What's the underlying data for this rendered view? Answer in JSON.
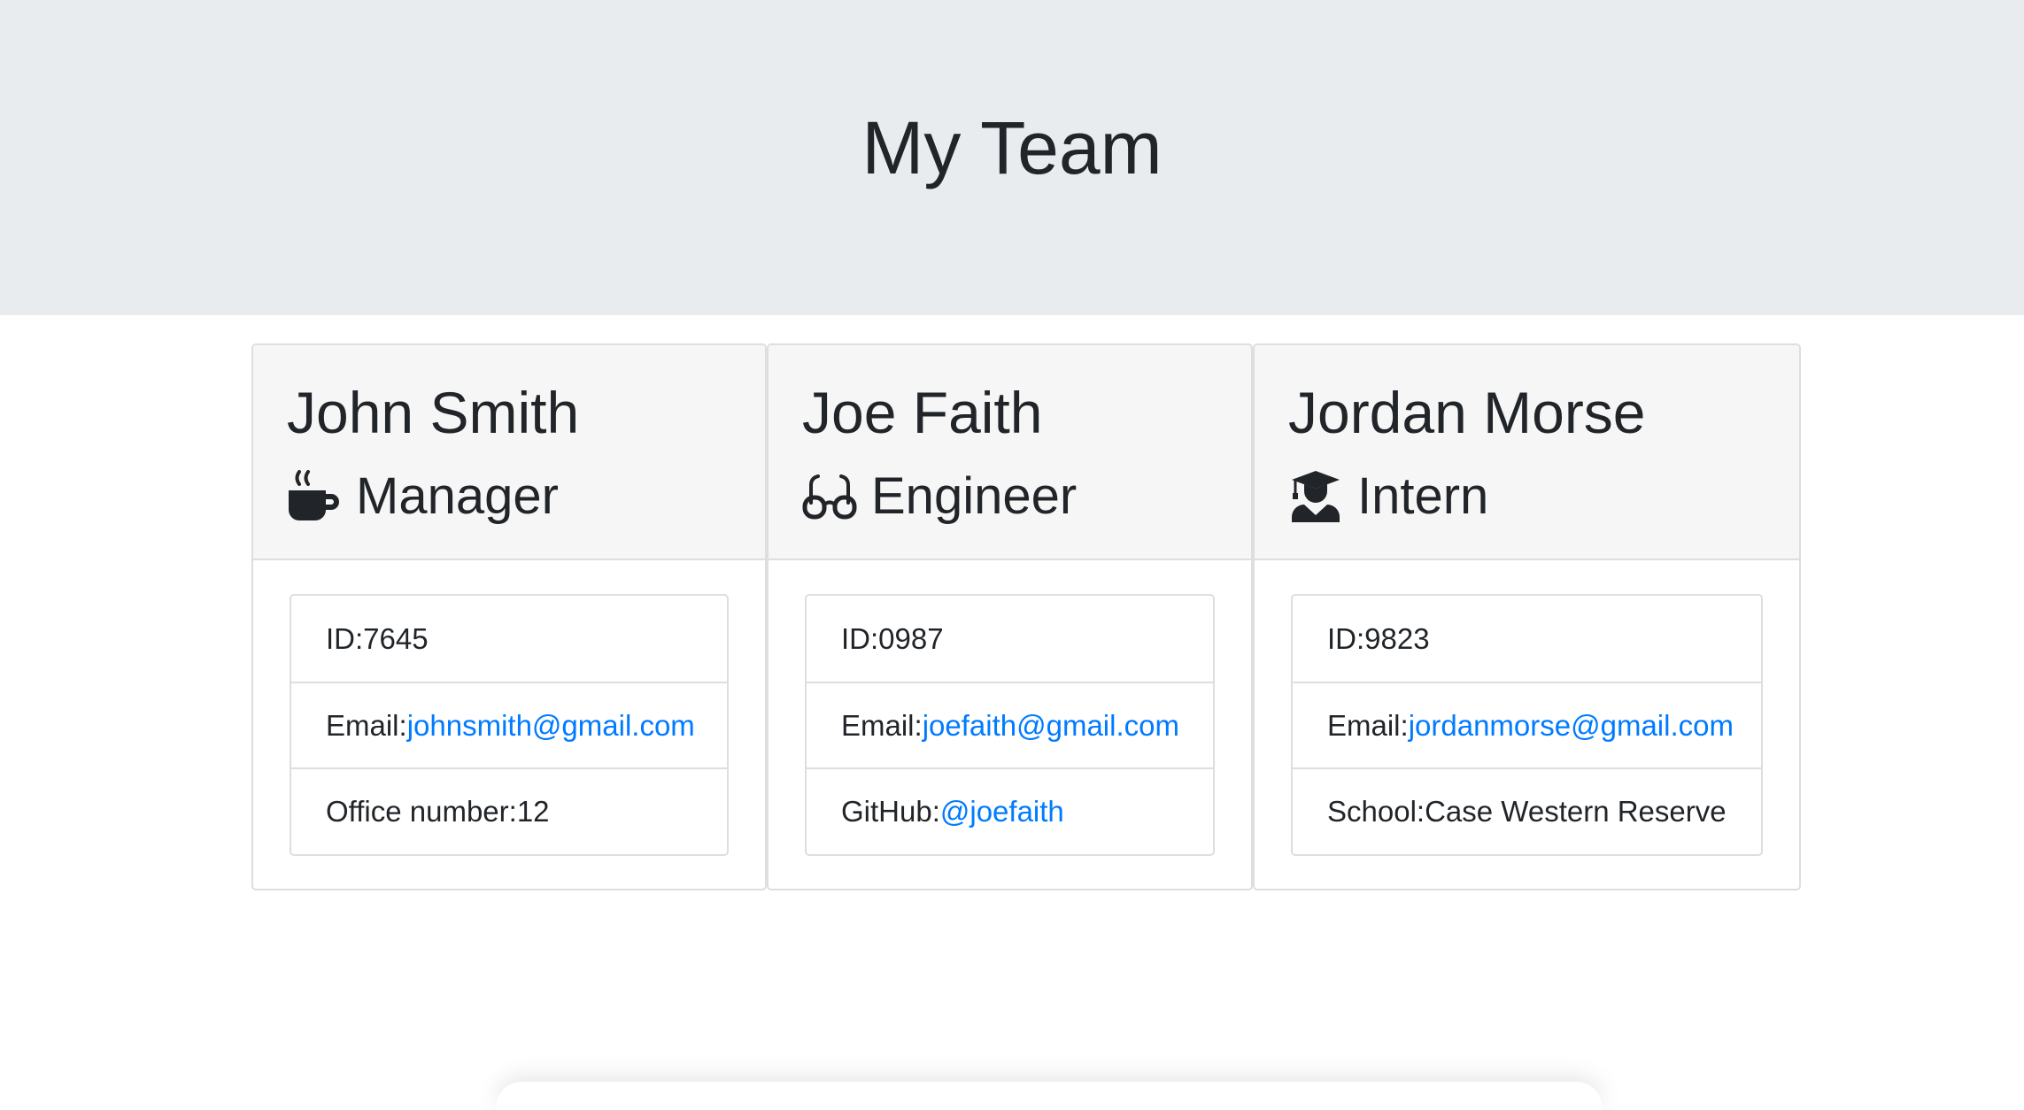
{
  "header": {
    "title": "My Team"
  },
  "employees": [
    {
      "name": "John Smith",
      "role": "Manager",
      "role_icon": "coffee-mug-icon",
      "id_label": "ID: ",
      "id": "7645",
      "email_label": "Email: ",
      "email": "johnsmith@gmail.com",
      "extra_label": "Office number: ",
      "extra_value": "12"
    },
    {
      "name": "Joe Faith",
      "role": "Engineer",
      "role_icon": "glasses-icon",
      "id_label": "ID: ",
      "id": "0987",
      "email_label": "Email: ",
      "email": "joefaith@gmail.com",
      "extra_label": "GitHub: ",
      "extra_value": "@joefaith"
    },
    {
      "name": "Jordan Morse",
      "role": "Intern",
      "role_icon": "graduate-icon",
      "id_label": "ID: ",
      "id": "9823",
      "email_label": "Email: ",
      "email": "jordanmorse@gmail.com",
      "extra_label": "School: ",
      "extra_value": "Case Western Reserve"
    }
  ],
  "colors": {
    "header_bg": "#e9ecef",
    "card_header_bg": "#f6f6f6",
    "link": "#007bff",
    "text": "#212529"
  }
}
